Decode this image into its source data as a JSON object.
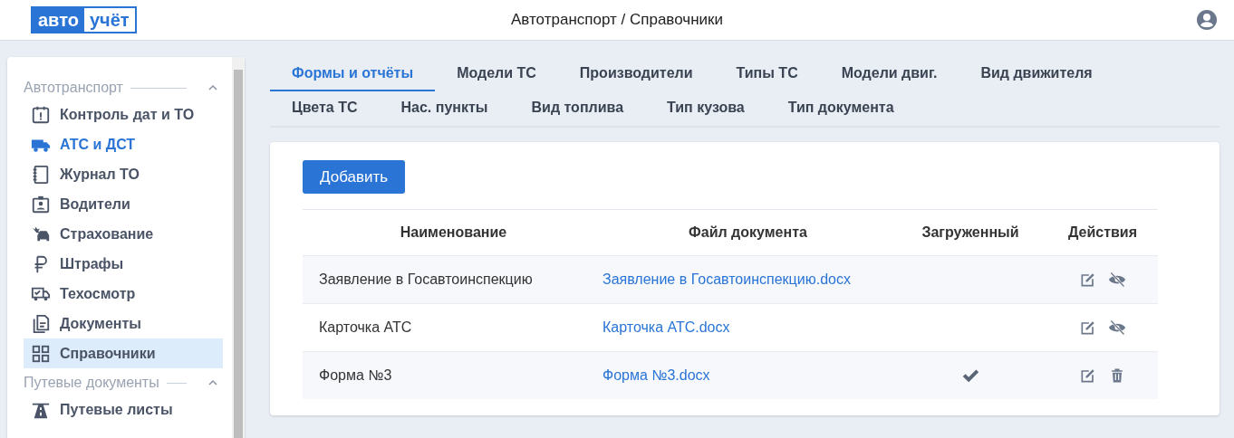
{
  "header": {
    "logo_left": "авто",
    "logo_right": "учёт",
    "title": "Автотранспорт / Справочники"
  },
  "sidebar": {
    "groups": [
      {
        "title": "Автотранспорт",
        "expanded": true,
        "items": [
          {
            "label": "Контроль дат и ТО",
            "selected": false,
            "active": false
          },
          {
            "label": "АТС и ДСТ",
            "selected": false,
            "active": true
          },
          {
            "label": "Журнал ТО",
            "selected": false,
            "active": false
          },
          {
            "label": "Водители",
            "selected": false,
            "active": false
          },
          {
            "label": "Страхование",
            "selected": false,
            "active": false
          },
          {
            "label": "Штрафы",
            "selected": false,
            "active": false
          },
          {
            "label": "Техосмотр",
            "selected": false,
            "active": false
          },
          {
            "label": "Документы",
            "selected": false,
            "active": false
          },
          {
            "label": "Справочники",
            "selected": true,
            "active": false
          }
        ]
      },
      {
        "title": "Путевые документы",
        "expanded": true,
        "items": [
          {
            "label": "Путевые листы",
            "selected": false,
            "active": false
          }
        ]
      }
    ]
  },
  "tab_rows": [
    [
      {
        "label": "Формы и отчёты",
        "selected": true
      },
      {
        "label": "Модели ТС",
        "selected": false
      },
      {
        "label": "Производители",
        "selected": false
      },
      {
        "label": "Типы ТС",
        "selected": false
      },
      {
        "label": "Модели двиг.",
        "selected": false
      },
      {
        "label": "Вид движителя",
        "selected": false
      }
    ],
    [
      {
        "label": "Цвета ТС",
        "selected": false
      },
      {
        "label": "Нас. пункты",
        "selected": false
      },
      {
        "label": "Вид топлива",
        "selected": false
      },
      {
        "label": "Тип кузова",
        "selected": false
      },
      {
        "label": "Тип документа",
        "selected": false
      }
    ]
  ],
  "add_button": "Добавить",
  "table": {
    "columns": [
      "Наименование",
      "Файл документа",
      "Загруженный",
      "Действия"
    ],
    "rows": [
      {
        "name": "Заявление в Госавтоинспекцию",
        "file": "Заявление в Госавтоинспекцию.docx",
        "uploaded": false,
        "actions": [
          {
            "kind": "edit"
          },
          {
            "kind": "hide"
          }
        ]
      },
      {
        "name": "Карточка АТС",
        "file": "Карточка АТС.docx",
        "uploaded": false,
        "actions": [
          {
            "kind": "edit"
          },
          {
            "kind": "hide"
          }
        ]
      },
      {
        "name": "Форма №3",
        "file": "Форма №3.docx",
        "uploaded": true,
        "actions": [
          {
            "kind": "edit"
          },
          {
            "kind": "delete"
          }
        ]
      }
    ]
  }
}
